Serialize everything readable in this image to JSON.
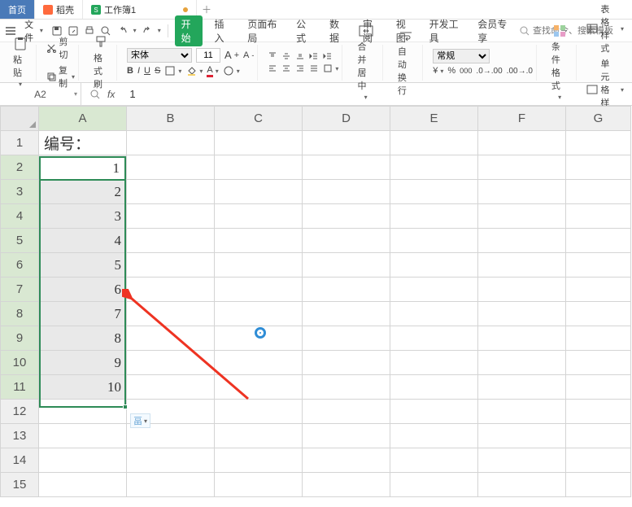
{
  "titlebar": {
    "tabs": [
      {
        "label": "首页",
        "icon": "home-icon"
      },
      {
        "label": "稻壳",
        "icon": "docer-icon"
      },
      {
        "label": "工作簿1",
        "icon": "sheet-icon",
        "dirty": true
      }
    ]
  },
  "menubar": {
    "file_label": "文件",
    "ribbon_tabs": [
      "开始",
      "插入",
      "页面布局",
      "公式",
      "数据",
      "审阅",
      "视图",
      "开发工具",
      "会员专享"
    ],
    "active_tab": "开始",
    "search_placeholder": "查找命令、搜索模板"
  },
  "ribbon": {
    "paste": "粘贴",
    "cut": "剪切",
    "copy": "复制",
    "format_painter": "格式刷",
    "font_name": "宋体",
    "font_size": "11",
    "merge_center": "合并居中",
    "wrap_text": "自动换行",
    "number_format": "常规",
    "cond_format": "条件格式",
    "cell_style": "表格样式",
    "cell_format": "单元格样式"
  },
  "formula_bar": {
    "name_box": "A2",
    "formula_value": "1"
  },
  "grid": {
    "columns": [
      "A",
      "B",
      "C",
      "D",
      "E",
      "F",
      "G"
    ],
    "rows": [
      1,
      2,
      3,
      4,
      5,
      6,
      7,
      8,
      9,
      10,
      11,
      12,
      13,
      14,
      15
    ],
    "header_cell": "编号：",
    "sel_values": [
      "1",
      "2",
      "3",
      "4",
      "5",
      "6",
      "7",
      "8",
      "9",
      "10"
    ],
    "qa_label": "畐"
  },
  "chart_data": {
    "type": "table",
    "note": "Spreadsheet column A rows 2–11 filled with sequential integers 1 through 10; A1 is label 编号： (meaning 'Number:'). Selection A2:A11 active cell A2.",
    "columns": [
      "编号："
    ],
    "values": [
      1,
      2,
      3,
      4,
      5,
      6,
      7,
      8,
      9,
      10
    ]
  }
}
